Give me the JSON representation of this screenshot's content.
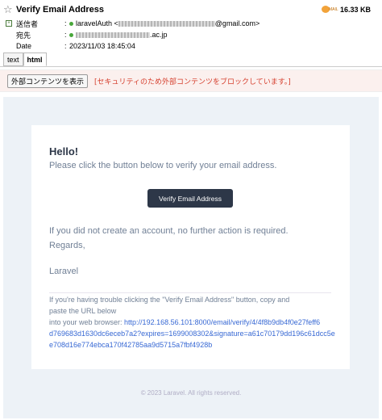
{
  "header": {
    "subject": "Verify Email Address",
    "size": "16.33 KB",
    "size_icon_text": "MAIL",
    "from_label": "送信者",
    "from_name": "laravelAuth <",
    "from_domain": "@gmail.com>",
    "to_label": "宛先",
    "to_domain": ".ac.jp",
    "date_label": "Date",
    "date_value": "2023/11/03 18:45:04",
    "colon": ":"
  },
  "tabs": [
    {
      "label": "text"
    },
    {
      "label": "html"
    }
  ],
  "external": {
    "button_label": "外部コンテンツを表示",
    "notice": "[セキュリティのため外部コンテンツをブロックしています。]"
  },
  "email": {
    "greeting": "Hello!",
    "intro": "Please click the button below to verify your email address.",
    "button_label": "Verify Email Address",
    "outro": "If you did not create an account, no further action is required.",
    "salutation": "Regards,",
    "signature": "Laravel",
    "subcopy_line1": "If you're having trouble clicking the \"Verify Email Address\" button, copy and",
    "subcopy_line2": "paste the URL below",
    "subcopy_line3_prefix": "into your web browser: ",
    "url_part1": "http://192.168.56.101:8000/email/verify/4/4f8b9db4f0e27feff6",
    "url_part2": "d769683d1630dc6eceb7a2?expires=1699008302&signature=a61c70179dd196c61dcc5e",
    "url_part3": "e708d16e774ebca170f42785aa9d5715a7fbf4928b",
    "footer": "© 2023 Laravel. All rights reserved."
  },
  "colors": {
    "button_bg": "#2d3748",
    "text_muted": "#718096",
    "link": "#3869d4",
    "notice": "#d6402f",
    "body_bg": "#edf2f7"
  }
}
